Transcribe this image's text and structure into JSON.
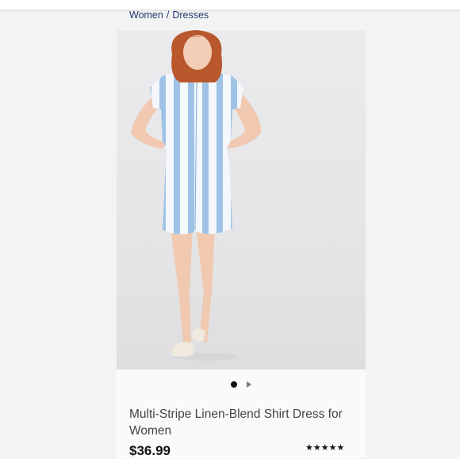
{
  "breadcrumb": {
    "category": "Women",
    "separator": "/",
    "subcategory": "Dresses"
  },
  "carousel": {
    "total_images_indicator": "1 of 2",
    "active_index": 0
  },
  "product": {
    "name": "Multi-Stripe Linen-Blend Shirt Dress for Women",
    "price": "$36.99",
    "rating_stars": "★★★★★",
    "rating_value": 4.5,
    "rating_max": 5
  },
  "colors": {
    "breadcrumb_text": "#1f3b73",
    "stripe_blue": "#9fc3e6",
    "price_text": "#111111"
  }
}
